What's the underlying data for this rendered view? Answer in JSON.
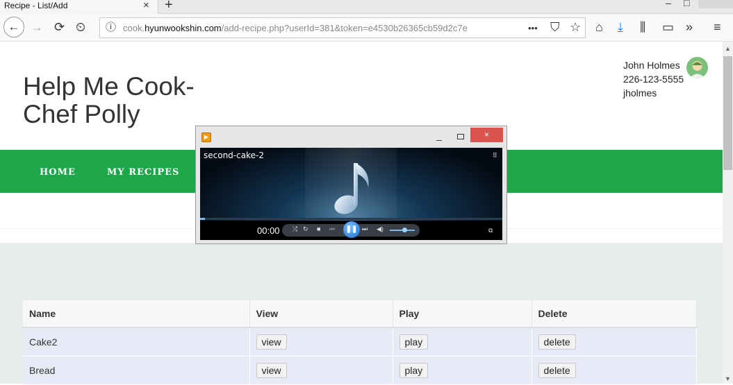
{
  "browser": {
    "tab_title": "Recipe - List/Add",
    "tab_close": "×",
    "new_tab": "+",
    "url_prefix": "cook.",
    "url_host": "hyunwookshin.com",
    "url_path": "/add-recipe.php?userId=381&token=e4530b26365cb59d2c7e",
    "info_icon": "ⓘ",
    "icons": {
      "back": "←",
      "forward": "→",
      "reload": "⟳",
      "history": "⏲",
      "more": "•••",
      "pocket": "⛉",
      "star": "☆",
      "home": "⌂",
      "download": "⤓",
      "library": "⫼",
      "sidebar": "▭",
      "overflow": "»",
      "menu": "≡",
      "minimize": "–",
      "maximize": "□"
    }
  },
  "site": {
    "title": "Help Me Cook- Chef Polly",
    "user": {
      "name": "John Holmes",
      "phone": "226-123-5555",
      "username": "jholmes"
    },
    "nav": [
      "HOME",
      "MY RECIPES"
    ]
  },
  "table": {
    "headers": [
      "Name",
      "View",
      "Play",
      "Delete"
    ],
    "rows": [
      {
        "name": "Cake2",
        "view": "view",
        "play": "play",
        "delete": "delete"
      },
      {
        "name": "Bread",
        "view": "view",
        "play": "play",
        "delete": "delete"
      }
    ]
  },
  "player": {
    "logo": "▶",
    "minimize": "_",
    "close": "×",
    "file_name": "second-cake-2",
    "grid_icon": "⠿",
    "time": "00:00",
    "play_state": "paused",
    "pause_glyph": "❚❚",
    "seek_progress_percent": 1.5,
    "volume_percent": 60,
    "controls": {
      "shuffle": "⤮",
      "repeat": "↻",
      "stop": "■",
      "previous": "⏮",
      "next": "⏭",
      "mute": "◀)",
      "switch_view": "⧉"
    }
  },
  "scrollbar": {
    "up": "▲",
    "down": "▼"
  }
}
